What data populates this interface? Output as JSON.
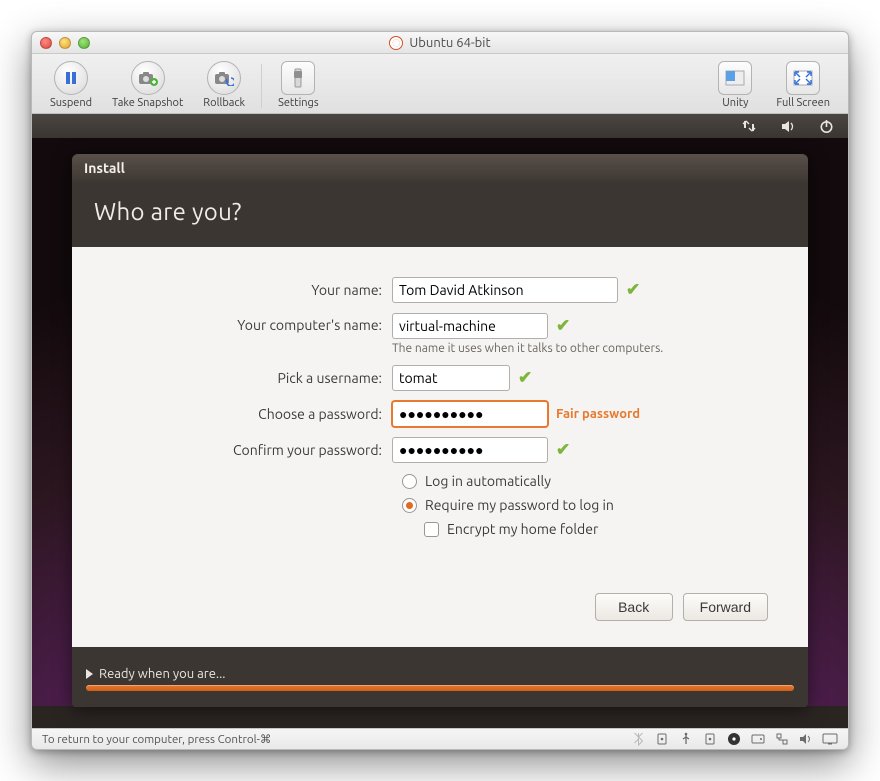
{
  "window": {
    "title": "Ubuntu 64-bit"
  },
  "toolbar": {
    "suspend": "Suspend",
    "snapshot": "Take Snapshot",
    "rollback": "Rollback",
    "settings": "Settings",
    "unity": "Unity",
    "fullscreen": "Full Screen"
  },
  "installer": {
    "window_title": "Install",
    "heading": "Who are you?",
    "labels": {
      "name": "Your name:",
      "computer": "Your computer's name:",
      "username": "Pick a username:",
      "password": "Choose a password:",
      "confirm": "Confirm your password:"
    },
    "values": {
      "name": "Tom David Atkinson",
      "computer": "virtual-machine",
      "username": "tomat",
      "password": "●●●●●●●●●●",
      "confirm": "●●●●●●●●●●"
    },
    "hint_computer": "The name it uses when it talks to other computers.",
    "pw_strength": "Fair password",
    "options": {
      "auto": "Log in automatically",
      "require": "Require my password to log in",
      "encrypt": "Encrypt my home folder"
    },
    "buttons": {
      "back": "Back",
      "forward": "Forward"
    },
    "progress_text": "Ready when you are..."
  },
  "statusbar": {
    "hint": "To return to your computer, press Control-⌘"
  }
}
